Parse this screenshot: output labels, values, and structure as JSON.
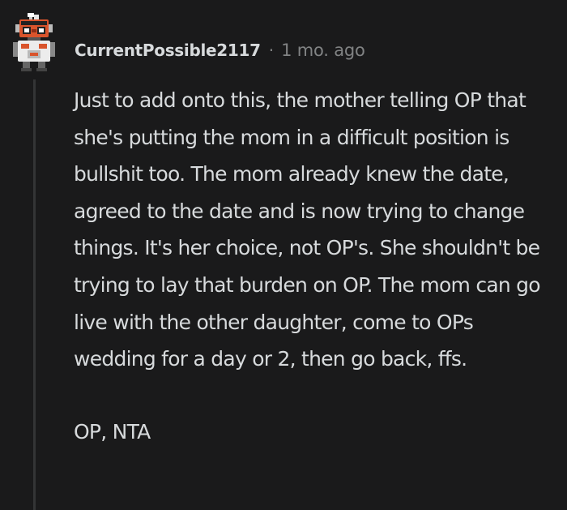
{
  "comment": {
    "username": "CurrentPossible2117",
    "separator": "·",
    "timestamp": "1 mo. ago",
    "avatar_icon": "robot-avatar-icon",
    "paragraphs": [
      "Just to add onto this, the mother telling OP that she's putting the mom in a difficult position is bullshit too. The mom already knew the date, agreed to the date and is now trying to change things. It's her choice, not OP's. She shouldn't be trying to lay that burden on OP. The mom can go live with the other daughter, come to OPs wedding for a day or 2, then go back, ffs.",
      "OP, NTA"
    ]
  },
  "colors": {
    "background": "#1a1a1b",
    "text": "#d7dadc",
    "muted": "#818384",
    "thread_line": "#343536",
    "avatar_accent": "#d9542c"
  }
}
